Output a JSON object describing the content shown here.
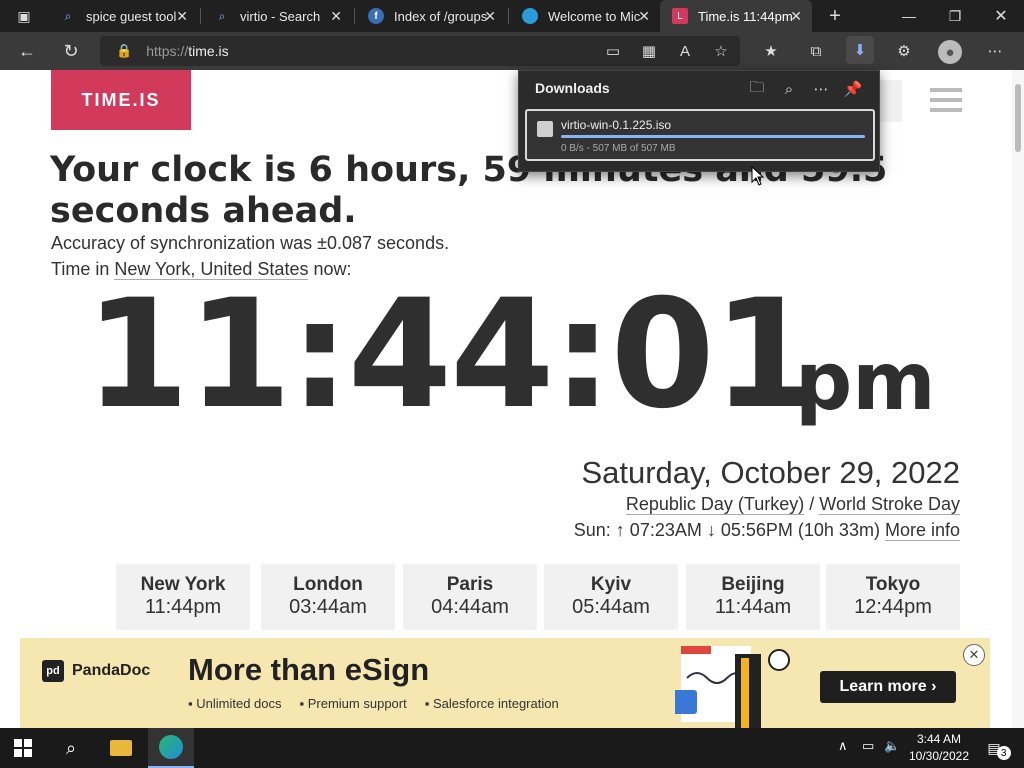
{
  "browser": {
    "tabs": [
      {
        "title": "spice guest tool",
        "icon": "search-icon"
      },
      {
        "title": "virtio - Search",
        "icon": "search-icon"
      },
      {
        "title": "Index of /groups",
        "icon": "fedora-icon"
      },
      {
        "title": "Welcome to Mic",
        "icon": "edge-icon"
      },
      {
        "title": "Time.is 11:44pm",
        "icon": "timeis-icon"
      }
    ],
    "url": "https://time.is",
    "url_scheme": "https://",
    "url_host": "time.is"
  },
  "downloads": {
    "title": "Downloads",
    "item": {
      "filename": "virtio-win-0.1.225.iso",
      "status": "0 B/s - 507 MB of 507 MB",
      "progress": 1.0
    }
  },
  "page": {
    "logo": "TIME.IS",
    "headline": "Your clock is 6 hours, 59 minutes and 59.5 seconds ahead.",
    "accuracy": "Accuracy of synchronization was ±0.087 seconds.",
    "location_prefix": "Time in ",
    "location_link": "New York, United States",
    "location_suffix": " now:",
    "time": "11:44:01",
    "ampm": "pm",
    "date": "Saturday, October 29, 2022",
    "holiday_1": "Republic Day (Turkey)",
    "holiday_sep": " / ",
    "holiday_2": "World Stroke Day",
    "sun_prefix": "Sun: ↑ 07:23AM ↓ 05:56PM (10h 33m) ",
    "more_info": "More info",
    "cities": [
      {
        "name": "New York",
        "time": "11:44pm"
      },
      {
        "name": "London",
        "time": "03:44am"
      },
      {
        "name": "Paris",
        "time": "04:44am"
      },
      {
        "name": "Kyiv",
        "time": "05:44am"
      },
      {
        "name": "Beijing",
        "time": "11:44am"
      },
      {
        "name": "Tokyo",
        "time": "12:44pm"
      }
    ]
  },
  "ad": {
    "brand": "PandaDoc",
    "title": "More than eSign",
    "bullets": [
      "Unlimited docs",
      "Premium support",
      "Salesforce integration"
    ],
    "cta": "Learn more ›"
  },
  "taskbar": {
    "time": "3:44 AM",
    "date": "10/30/2022",
    "notifications": "3"
  },
  "colors": {
    "logo_bg": "#d2395a",
    "ad_bg": "#f6e7b1",
    "tab_bg": "#202020",
    "toolbar_bg": "#3a3a3a"
  }
}
